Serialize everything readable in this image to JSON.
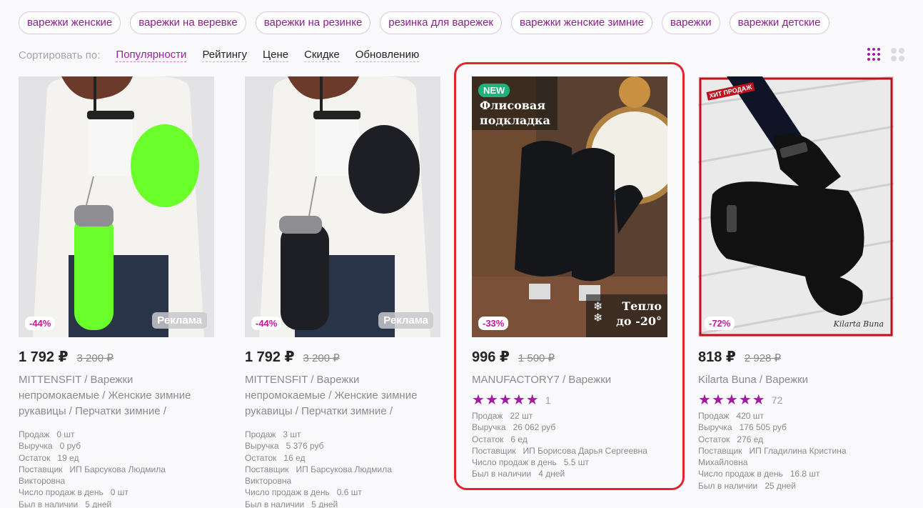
{
  "tags": [
    "варежки женские",
    "варежки на веревке",
    "варежки на резинке",
    "резинка для варежек",
    "варежки женские зимние",
    "варежки",
    "варежки детские"
  ],
  "sort": {
    "label": "Сортировать по:",
    "options": [
      "Популярности",
      "Рейтингу",
      "Цене",
      "Скидке",
      "Обновлению"
    ],
    "active": "Популярности"
  },
  "colors": {
    "accent": "#a31ba3",
    "highlight": "#e0262f"
  },
  "stat_labels": {
    "sales": "Продаж",
    "revenue": "Выручка",
    "stock": "Остаток",
    "supplier": "Поставщик",
    "per_day": "Число продаж в день",
    "in_stock_days": "Был в наличии"
  },
  "products": [
    {
      "discount": "-44%",
      "ad": "Реклама",
      "price": "1 792 ₽",
      "old_price": "3 200 ₽",
      "title": "MITTENSFIT / Варежки непромокаемые / Женские зимние рукавицы / Перчатки зимние /",
      "sales": "0 шт",
      "revenue": "0 руб",
      "stock": "19 ед",
      "supplier": "ИП Барсукова Людмила Викторовна",
      "per_day": "0 шт",
      "in_stock_days": "5 дней",
      "mitten_color": "#6aff2a"
    },
    {
      "discount": "-44%",
      "ad": "Реклама",
      "price": "1 792 ₽",
      "old_price": "3 200 ₽",
      "title": "MITTENSFIT / Варежки непромокаемые / Женские зимние рукавицы / Перчатки зимние /",
      "sales": "3 шт",
      "revenue": "5 376 руб",
      "stock": "16 ед",
      "supplier": "ИП Барсукова Людмила Викторовна",
      "per_day": "0.6 шт",
      "in_stock_days": "5 дней",
      "mitten_color": "#1e1f24"
    },
    {
      "discount": "-33%",
      "new": "NEW",
      "overlay_top": "Флисовая подкладка",
      "overlay_bottom": "Тепло до -20°",
      "price": "996 ₽",
      "old_price": "1 500 ₽",
      "title": "MANUFACTORY7 / Варежки",
      "rating": 5,
      "reviews": "1",
      "sales": "22 шт",
      "revenue": "26 062 руб",
      "stock": "6 ед",
      "supplier": "ИП Борисова Дарья Сергеевна",
      "per_day": "5.5 шт",
      "in_stock_days": "4 дней"
    },
    {
      "discount": "-72%",
      "hit": "ХИТ ПРОДАЖ",
      "signature": "Kilarta Buna",
      "price": "818 ₽",
      "old_price": "2 928 ₽",
      "title": "Kilarta Buna / Варежки",
      "rating": 5,
      "reviews": "72",
      "sales": "420 шт",
      "revenue": "176 505 руб",
      "stock": "276 ед",
      "supplier": "ИП Гладилина Кристина Михайловна",
      "per_day": "16.8 шт",
      "in_stock_days": "25 дней"
    }
  ]
}
